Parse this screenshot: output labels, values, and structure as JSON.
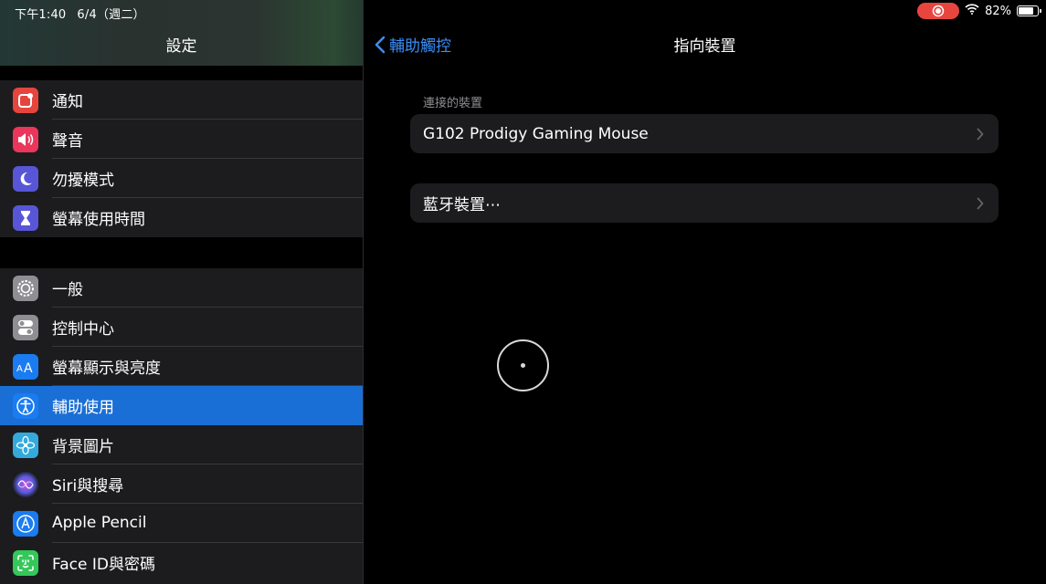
{
  "status_bar": {
    "time": "下午1:40",
    "date": "6/4（週二）",
    "battery": "82%",
    "battery_fraction": 0.82
  },
  "sidebar": {
    "title": "設定",
    "groups": [
      {
        "items": [
          {
            "label": "通知",
            "icon": "notification-icon",
            "color": "#e5453d"
          },
          {
            "label": "聲音",
            "icon": "speaker-icon",
            "color": "#e9365a"
          },
          {
            "label": "勿擾模式",
            "icon": "moon-icon",
            "color": "#5856d6"
          },
          {
            "label": "螢幕使用時間",
            "icon": "hourglass-icon",
            "color": "#5856d6"
          }
        ]
      },
      {
        "items": [
          {
            "label": "一般",
            "icon": "gear-icon",
            "color": "#8e8e93"
          },
          {
            "label": "控制中心",
            "icon": "toggles-icon",
            "color": "#8e8e93"
          },
          {
            "label": "螢幕顯示與亮度",
            "icon": "text-size-icon",
            "color": "#1a7cf0"
          },
          {
            "label": "輔助使用",
            "icon": "accessibility-icon",
            "color": "#1a7cf0",
            "selected": true
          },
          {
            "label": "背景圖片",
            "icon": "flower-icon",
            "color": "#34aadc"
          },
          {
            "label": "Siri與搜尋",
            "icon": "siri-icon",
            "color": "#1a1a1a"
          },
          {
            "label": "Apple Pencil",
            "icon": "pencil-icon",
            "color": "#1a7cf0"
          },
          {
            "label": "Face ID與密碼",
            "icon": "face-id-icon",
            "color": "#34c759"
          }
        ]
      }
    ]
  },
  "detail": {
    "back_label": "輔助觸控",
    "title": "指向裝置",
    "section_header": "連接的裝置",
    "connected_device": "G102 Prodigy Gaming Mouse",
    "bluetooth_label": "藍牙裝置⋯"
  }
}
